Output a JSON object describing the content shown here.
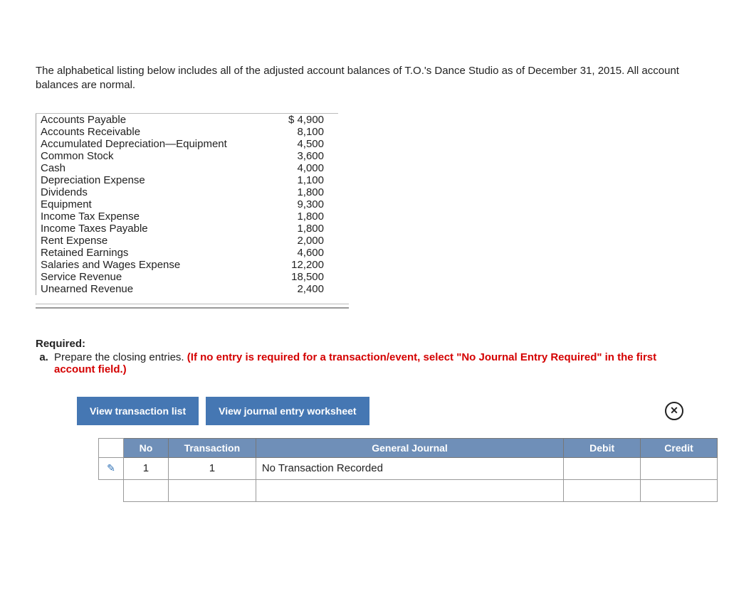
{
  "intro": "The alphabetical listing below includes all of the adjusted account balances of T.O.'s Dance Studio as of December 31, 2015. All account balances are normal.",
  "balances": [
    {
      "name": "Accounts Payable",
      "value": "$ 4,900"
    },
    {
      "name": "Accounts Receivable",
      "value": "8,100"
    },
    {
      "name": "Accumulated Depreciation—Equipment",
      "value": "4,500"
    },
    {
      "name": "Common Stock",
      "value": "3,600"
    },
    {
      "name": "Cash",
      "value": "4,000"
    },
    {
      "name": "Depreciation Expense",
      "value": "1,100"
    },
    {
      "name": "Dividends",
      "value": "1,800"
    },
    {
      "name": "Equipment",
      "value": "9,300"
    },
    {
      "name": "Income Tax Expense",
      "value": "1,800"
    },
    {
      "name": "Income Taxes Payable",
      "value": "1,800"
    },
    {
      "name": "Rent Expense",
      "value": "2,000"
    },
    {
      "name": "Retained Earnings",
      "value": "4,600"
    },
    {
      "name": "Salaries and Wages Expense",
      "value": "12,200"
    },
    {
      "name": "Service Revenue",
      "value": "18,500"
    },
    {
      "name": "Unearned Revenue",
      "value": "2,400"
    }
  ],
  "required_label": "Required:",
  "required_item_letter": "a.",
  "required_item_text": "Prepare the closing entries. ",
  "required_item_red": "(If no entry is required for a transaction/event, select \"No Journal Entry Required\" in the first account field.)",
  "buttons": {
    "view_transaction_list": "View transaction list",
    "view_journal_worksheet": "View journal entry worksheet"
  },
  "close_glyph": "✕",
  "pencil_glyph": "✎",
  "journal": {
    "headers": {
      "no": "No",
      "transaction": "Transaction",
      "general": "General Journal",
      "debit": "Debit",
      "credit": "Credit"
    },
    "rows": [
      {
        "no": "1",
        "transaction": "1",
        "general": "No Transaction Recorded",
        "debit": "",
        "credit": ""
      },
      {
        "no": "",
        "transaction": "",
        "general": "",
        "debit": "",
        "credit": ""
      }
    ]
  }
}
